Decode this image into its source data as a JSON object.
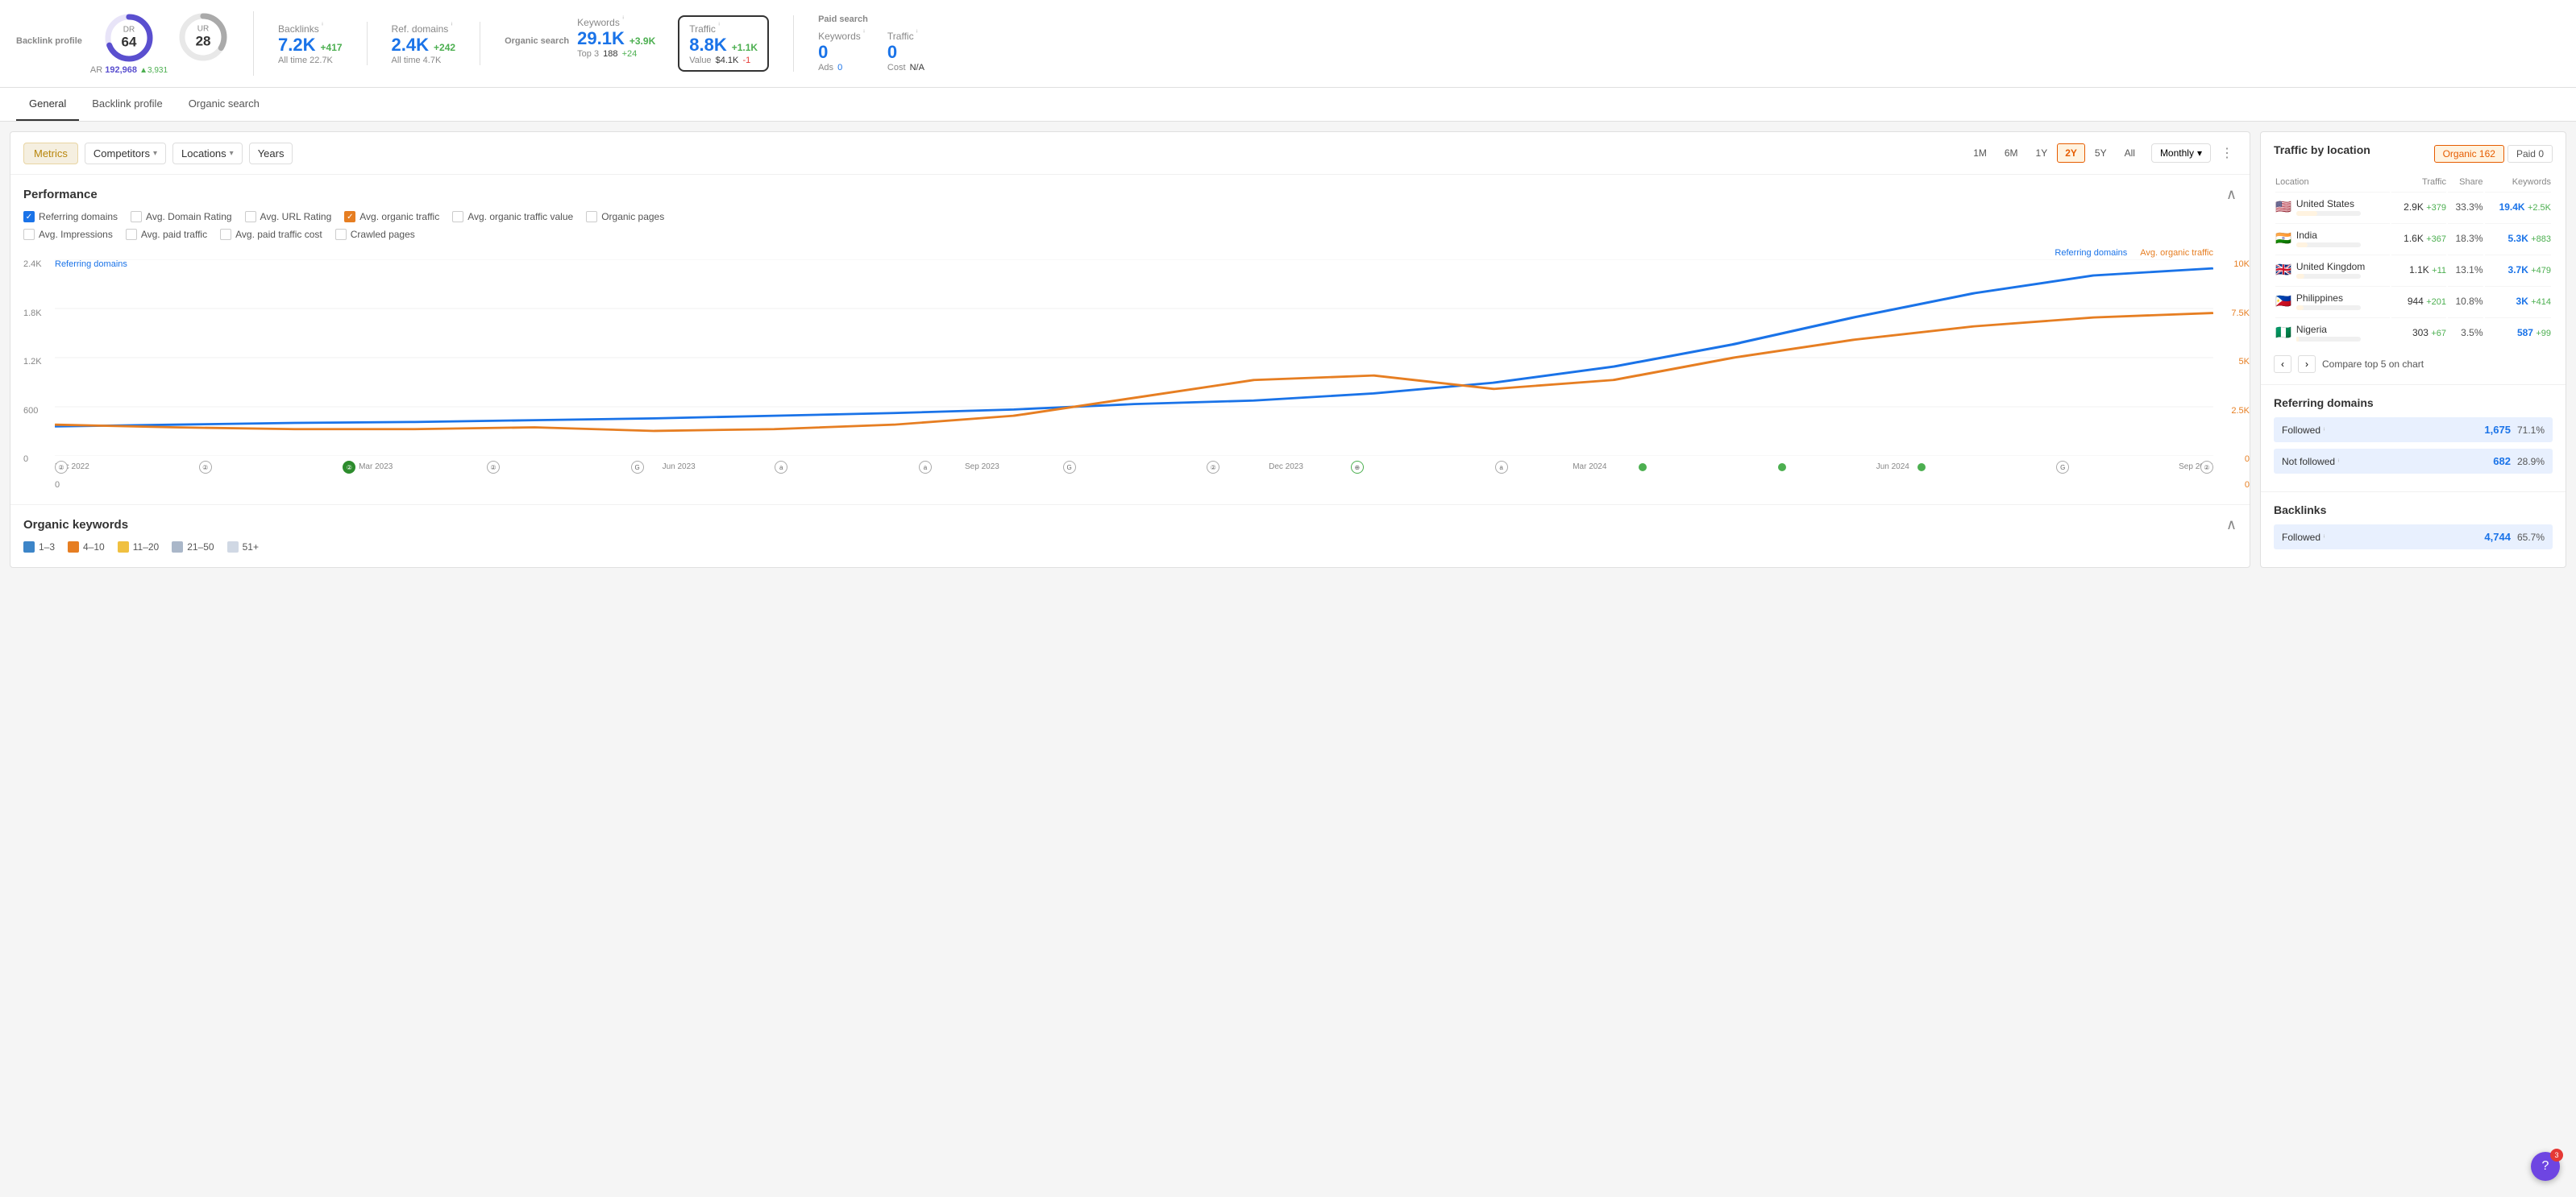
{
  "topbar": {
    "backlink_profile_label": "Backlink profile",
    "dr_label": "DR",
    "dr_value": "64",
    "ur_label": "UR",
    "ur_value": "28",
    "ar_label": "AR",
    "ar_value": "192,968",
    "ar_delta": "3,931",
    "backlinks_label": "Backlinks",
    "backlinks_value": "7.2K",
    "backlinks_delta": "+417",
    "backlinks_sub": "All time 22.7K",
    "ref_domains_label": "Ref. domains",
    "ref_domains_value": "2.4K",
    "ref_domains_delta": "+242",
    "ref_domains_sub": "All time 4.7K",
    "organic_search_label": "Organic search",
    "keywords_label": "Keywords",
    "keywords_value": "29.1K",
    "keywords_delta": "+3.9K",
    "keywords_sub_label": "Top 3",
    "keywords_sub_value": "188",
    "keywords_sub_delta": "+24",
    "traffic_label": "Traffic",
    "traffic_value": "8.8K",
    "traffic_delta": "+1.1K",
    "traffic_value_label": "Value",
    "traffic_value_value": "$4.1K",
    "traffic_value_delta": "-1",
    "paid_search_label": "Paid search",
    "paid_keywords_label": "Keywords",
    "paid_keywords_value": "0",
    "paid_ads_label": "Ads",
    "paid_ads_value": "0",
    "paid_traffic_label": "Traffic",
    "paid_traffic_value": "0",
    "paid_cost_label": "Cost",
    "paid_cost_value": "N/A"
  },
  "nav": {
    "tabs": [
      {
        "label": "General",
        "active": true
      },
      {
        "label": "Backlink profile",
        "active": false
      },
      {
        "label": "Organic search",
        "active": false
      }
    ]
  },
  "toolbar": {
    "metrics_label": "Metrics",
    "competitors_label": "Competitors",
    "locations_label": "Locations",
    "years_label": "Years",
    "time_buttons": [
      "1M",
      "6M",
      "1Y",
      "2Y",
      "5Y",
      "All"
    ],
    "active_time": "2Y",
    "monthly_label": "Monthly",
    "dots": "⋮"
  },
  "performance": {
    "title": "Performance",
    "checkboxes": [
      {
        "label": "Referring domains",
        "checked": true,
        "color": "blue"
      },
      {
        "label": "Avg. Domain Rating",
        "checked": false,
        "color": "none"
      },
      {
        "label": "Avg. URL Rating",
        "checked": false,
        "color": "none"
      },
      {
        "label": "Avg. organic traffic",
        "checked": true,
        "color": "orange"
      },
      {
        "label": "Avg. organic traffic value",
        "checked": false,
        "color": "none"
      },
      {
        "label": "Organic pages",
        "checked": false,
        "color": "none"
      },
      {
        "label": "Avg. Impressions",
        "checked": false,
        "color": "none"
      },
      {
        "label": "Avg. paid traffic",
        "checked": false,
        "color": "none"
      },
      {
        "label": "Avg. paid traffic cost",
        "checked": false,
        "color": "none"
      },
      {
        "label": "Crawled pages",
        "checked": false,
        "color": "none"
      }
    ],
    "chart_left_labels": [
      "2.4K",
      "1.8K",
      "1.2K",
      "600",
      "0"
    ],
    "chart_right_labels": [
      "10K",
      "7.5K",
      "5K",
      "2.5K",
      "0"
    ],
    "chart_x_labels": [
      "Dec 2022",
      "Mar 2023",
      "Jun 2023",
      "Sep 2023",
      "Dec 2023",
      "Mar 2024",
      "Jun 2024",
      "Sep 2024"
    ],
    "legend_blue": "Referring domains",
    "legend_orange": "Avg. organic traffic",
    "referring_label": "Referring domains"
  },
  "organic_keywords": {
    "title": "Organic keywords",
    "ranges": [
      {
        "label": "1–3",
        "color": "#3d85c8"
      },
      {
        "label": "4–10",
        "color": "#e67e22"
      },
      {
        "label": "11–20",
        "color": "#f0c040"
      },
      {
        "label": "21–50",
        "color": "#aab7c9"
      },
      {
        "label": "51+",
        "color": "#d0d8e4"
      }
    ]
  },
  "right_panel": {
    "traffic_by_location": {
      "title": "Traffic by location",
      "tab_organic": "Organic",
      "tab_organic_val": "162",
      "tab_paid": "Paid",
      "tab_paid_val": "0",
      "col_location": "Location",
      "col_traffic": "Traffic",
      "col_share": "Share",
      "col_keywords": "Keywords",
      "rows": [
        {
          "flag": "🇺🇸",
          "country": "United States",
          "traffic": "2.9K",
          "delta": "+379",
          "share": "33.3%",
          "bar_pct": 33,
          "kw": "19.4K",
          "kw_delta": "+2.5K"
        },
        {
          "flag": "🇮🇳",
          "country": "India",
          "traffic": "1.6K",
          "delta": "+367",
          "share": "18.3%",
          "bar_pct": 18,
          "kw": "5.3K",
          "kw_delta": "+883"
        },
        {
          "flag": "🇬🇧",
          "country": "United Kingdom",
          "traffic": "1.1K",
          "delta": "+11",
          "share": "13.1%",
          "bar_pct": 13,
          "kw": "3.7K",
          "kw_delta": "+479"
        },
        {
          "flag": "🇵🇭",
          "country": "Philippines",
          "traffic": "944",
          "delta": "+201",
          "share": "10.8%",
          "bar_pct": 11,
          "kw": "3K",
          "kw_delta": "+414"
        },
        {
          "flag": "🇳🇬",
          "country": "Nigeria",
          "traffic": "303",
          "delta": "+67",
          "share": "3.5%",
          "bar_pct": 4,
          "kw": "587",
          "kw_delta": "+99"
        }
      ],
      "compare_label": "Compare top 5 on chart"
    },
    "referring_domains": {
      "title": "Referring domains",
      "rows": [
        {
          "label": "Followed",
          "val": "1,675",
          "pct": "71.1%",
          "bar_pct": 71
        },
        {
          "label": "Not followed",
          "val": "682",
          "pct": "28.9%",
          "bar_pct": 29
        }
      ]
    },
    "backlinks": {
      "title": "Backlinks",
      "rows": [
        {
          "label": "Followed",
          "val": "4,744",
          "pct": "65.7%",
          "bar_pct": 66
        }
      ]
    }
  },
  "help": {
    "icon": "?",
    "badge": "3"
  }
}
